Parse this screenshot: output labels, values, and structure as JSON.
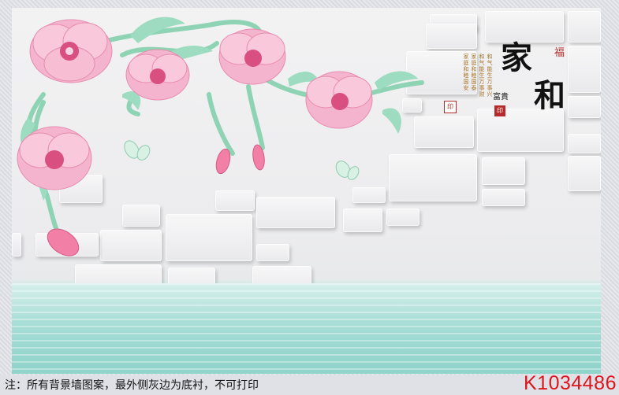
{
  "artwork": {
    "calligraphy": {
      "char1": "家",
      "char2": "和",
      "corner_mark": "福"
    },
    "subtitle": "富貴",
    "poem_columns": [
      "和气能生万事兴",
      "和气能生万事财",
      "家庭和睦国泰",
      "家庭和睦国安"
    ],
    "seals": [
      "印",
      "印"
    ],
    "colors": {
      "flower": "#f2a6c6",
      "leaf": "#8fd3b5",
      "water": "#a6ddd5"
    }
  },
  "footer": {
    "note": "注：所有背景墙图案，最外侧灰边为底衬，不可打印",
    "product_code": "K1034486",
    "code_color": "#e0141c"
  }
}
